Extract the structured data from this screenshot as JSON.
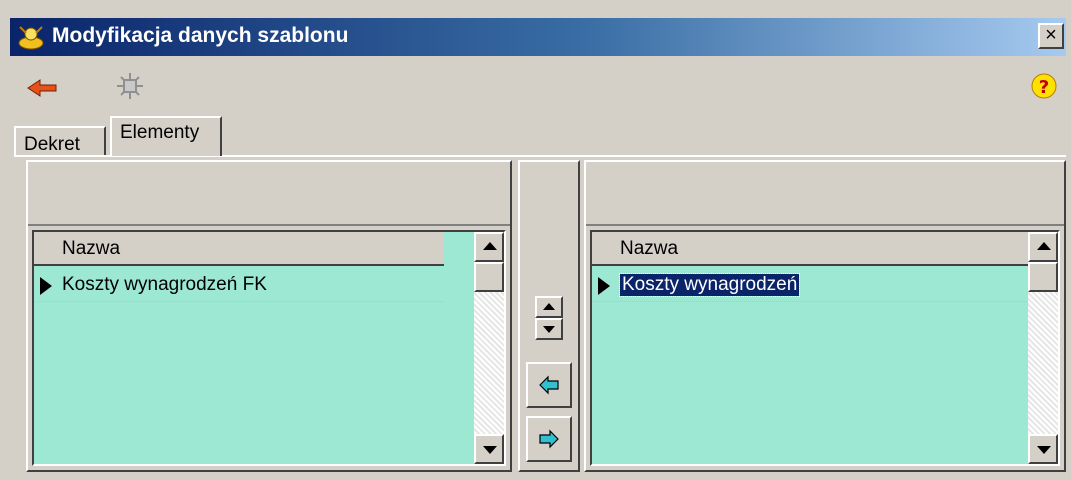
{
  "window": {
    "title": "Modyfikacja danych szablonu",
    "close_label": "×"
  },
  "toolbar": {
    "back_icon": "back-arrow-icon",
    "refresh_icon": "refresh-icon",
    "help_icon": "help-icon"
  },
  "tabs": [
    {
      "label": "Dekret",
      "active": false
    },
    {
      "label": "Elementy",
      "active": true
    }
  ],
  "left_list": {
    "header": "Nazwa",
    "rows": [
      {
        "label": "Koszty wynagrodzeń FK",
        "selected": false
      }
    ]
  },
  "right_list": {
    "header": "Nazwa",
    "rows": [
      {
        "label": "Koszty wynagrodzeń",
        "selected": true
      }
    ]
  },
  "middle": {
    "move_left_icon": "arrow-left-icon",
    "move_right_icon": "arrow-right-icon",
    "reorder_icon": "up-down-icon"
  },
  "colors": {
    "title_bar_start": "#0a246a",
    "grid_background": "#9de8d2",
    "window_face": "#d4d0c8",
    "selection": "#0a246a"
  }
}
